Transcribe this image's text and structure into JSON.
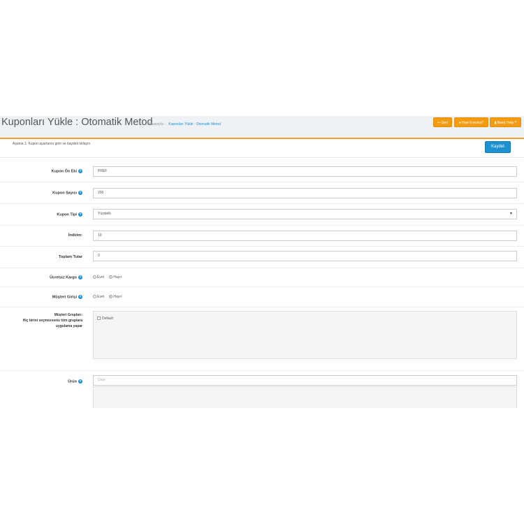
{
  "header": {
    "title": "Kuponları Yükle : Otomatik Metod",
    "breadcrumb": [
      "Anasayfa",
      "Kuponları Yükle : Otomatik Metod"
    ],
    "buttons": {
      "back": "Geri",
      "how": "How it works?",
      "help": "Need Help ?"
    }
  },
  "step": {
    "text": "Aşama 1: Kupon ayarlarını girin ve kaydeti tıklayın",
    "save_label": "Kaydet"
  },
  "form": {
    "prefix": {
      "label": "Kupon Ön Eki",
      "value": "PREF"
    },
    "count": {
      "label": "Kupon Sayısı",
      "value": "200"
    },
    "type": {
      "label": "Kupon Tipi",
      "value": "Yüzdelik"
    },
    "discount": {
      "label": "İndirim:",
      "value": "10"
    },
    "total": {
      "label": "Toplam Tutar",
      "value": "0"
    },
    "free_shipping": {
      "label": "Ücretsiz Kargo",
      "options": [
        "Evet",
        "Hayır"
      ],
      "selected": "Hayır"
    },
    "customer_login": {
      "label": "Müşteri Girişi",
      "options": [
        "Evet",
        "Hayır"
      ],
      "selected": "Hayır"
    },
    "customer_groups": {
      "label_line1": "Müşteri Grupları:",
      "label_line2": "Hiç birini seçmezseniz tüm gruplara",
      "label_line3": "uygulama yapar",
      "items": [
        "Default"
      ]
    },
    "product": {
      "label": "Ürün",
      "placeholder": "Ürün"
    }
  },
  "colors": {
    "accent": "#f39c12",
    "primary": "#1e91cf",
    "header_bg": "#eef1f5"
  }
}
